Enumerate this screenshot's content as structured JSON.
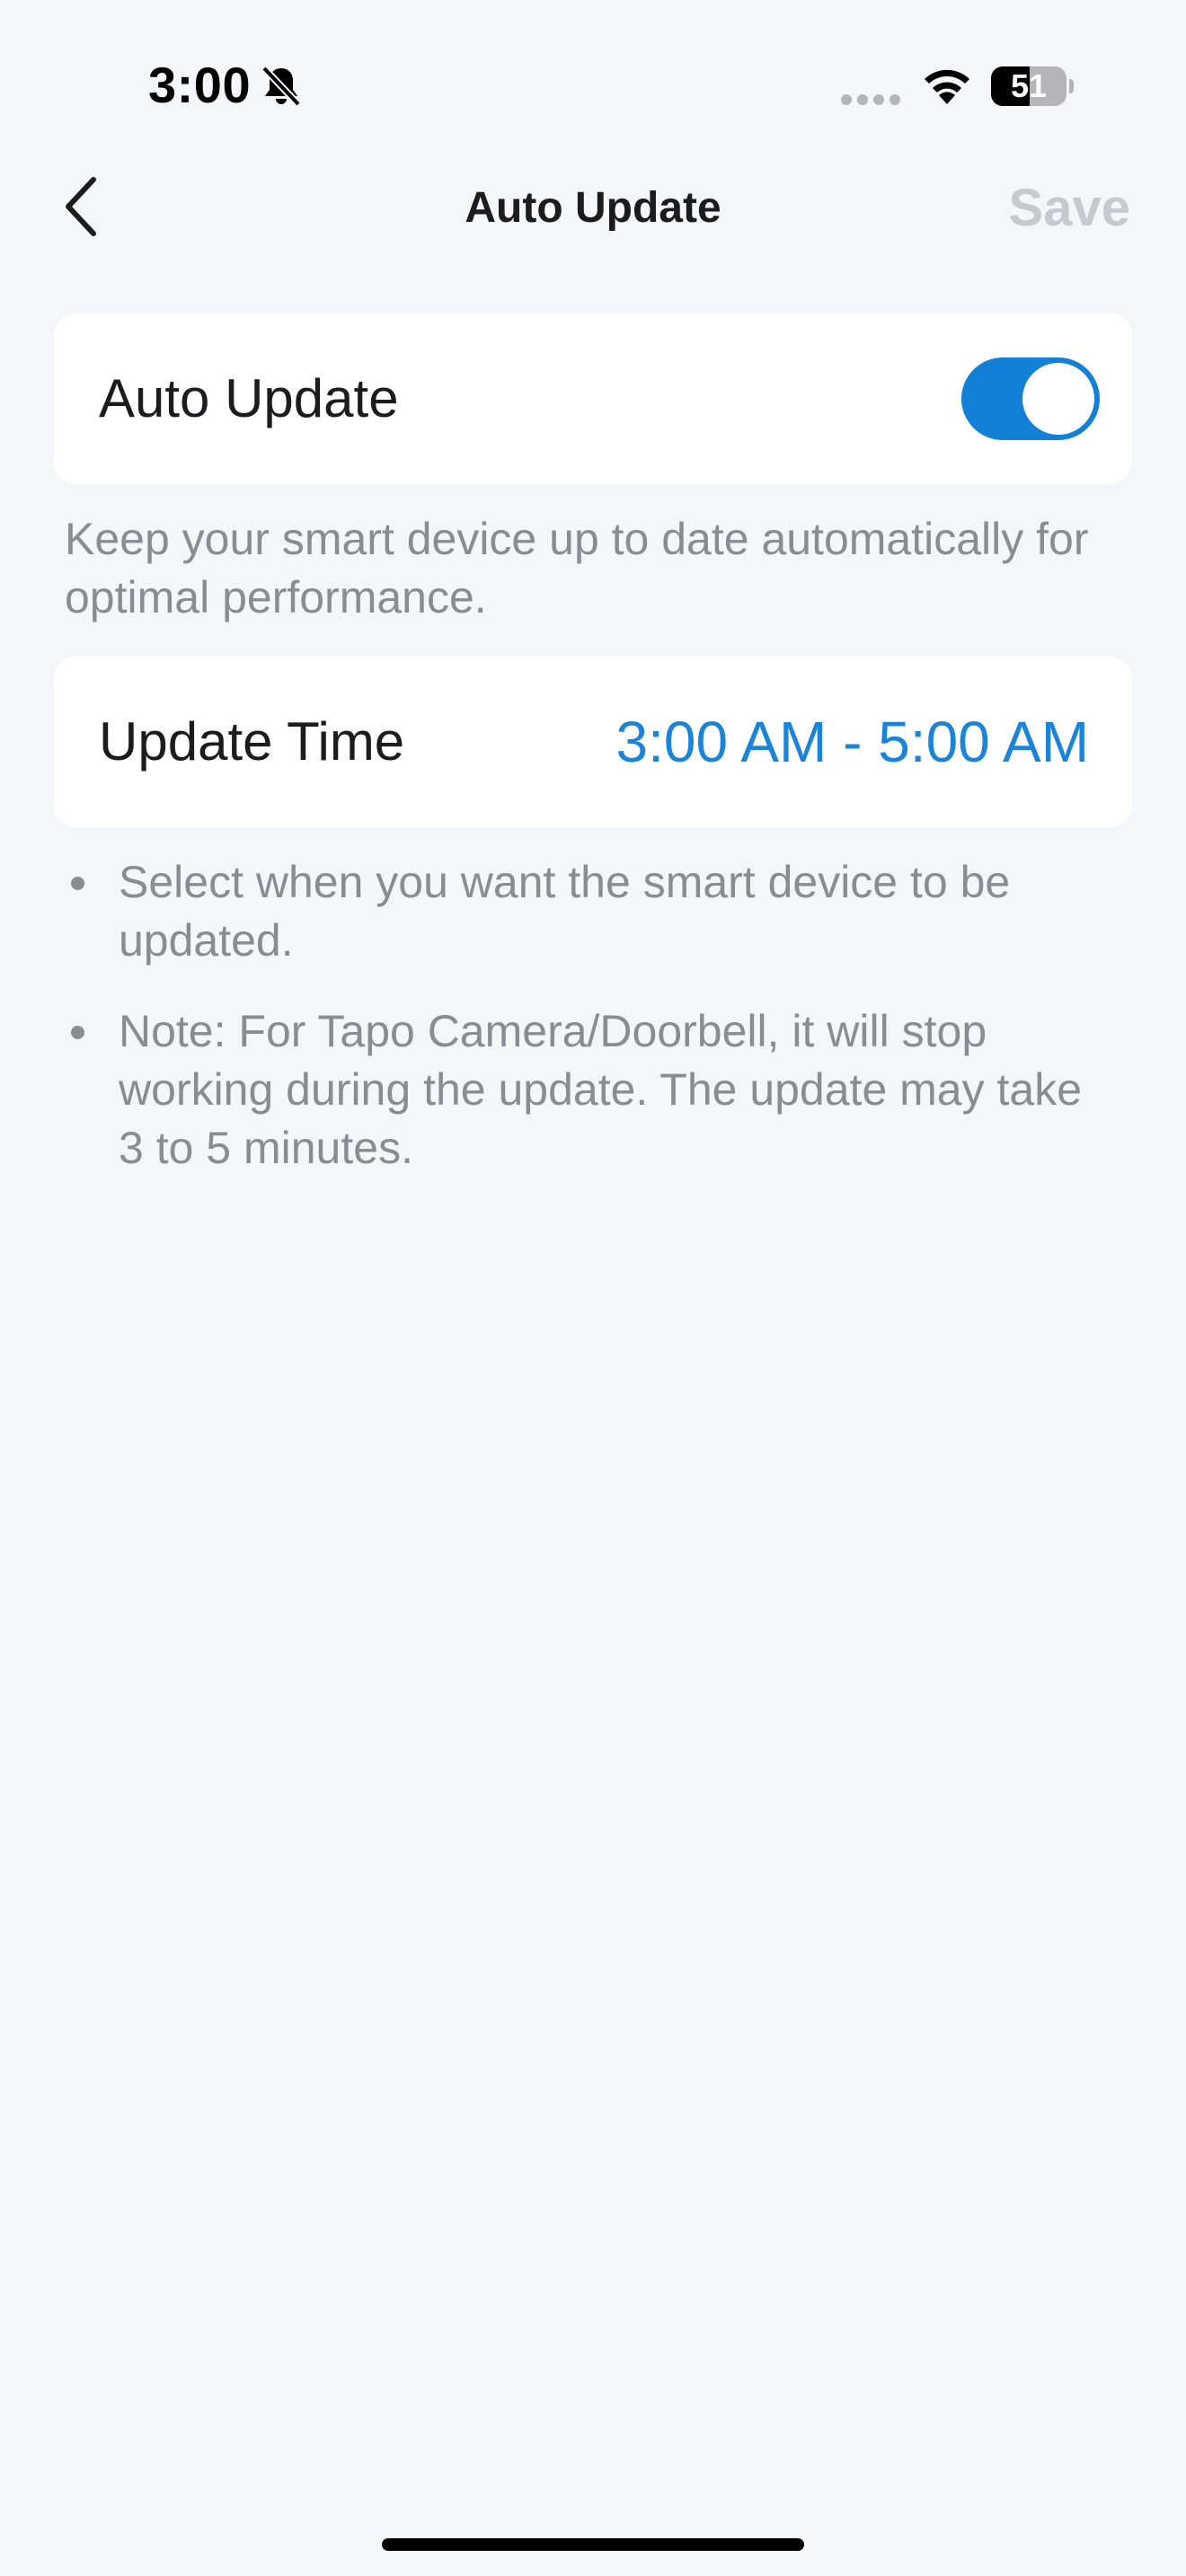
{
  "status_bar": {
    "time": "3:00",
    "battery_level": "51",
    "battery_fraction": 0.51
  },
  "nav": {
    "title": "Auto Update",
    "save_label": "Save",
    "back_icon": "chevron-left-icon"
  },
  "auto_update": {
    "label": "Auto Update",
    "enabled": true,
    "description": "Keep your smart device up to date automatically for optimal performance."
  },
  "update_time": {
    "label": "Update Time",
    "value": "3:00 AM - 5:00 AM"
  },
  "notes": [
    "Select when you want the smart device to be updated.",
    "Note: For Tapo Camera/Doorbell, it will stop working during the update. The update may take 3 to 5 minutes."
  ],
  "colors": {
    "accent": "#1380d7",
    "background": "#f4f6fa",
    "disabled_text": "#c7c9cf",
    "secondary_text": "#8a8c92"
  }
}
